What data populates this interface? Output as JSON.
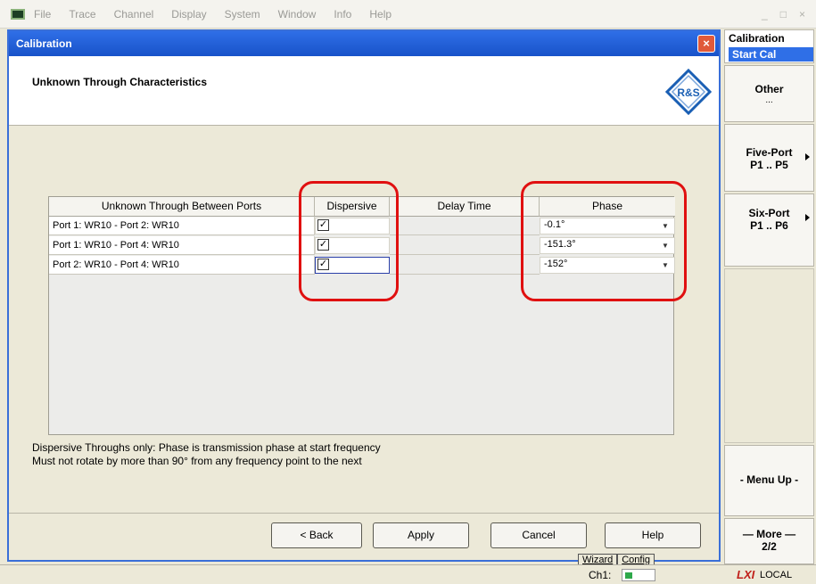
{
  "menubar": {
    "items": [
      "File",
      "Trace",
      "Channel",
      "Display",
      "System",
      "Window",
      "Info",
      "Help"
    ],
    "window_controls": [
      "_",
      "□",
      "×"
    ]
  },
  "dialog": {
    "title": "Calibration",
    "close_label": "×",
    "heading": "Unknown Through Characteristics",
    "logo_text": "R&S"
  },
  "grid": {
    "columns": [
      "Unknown Through Between Ports",
      "Dispersive",
      "Delay Time",
      "Phase"
    ],
    "rows": [
      {
        "ports": "Port 1: WR10 - Port 2: WR10",
        "dispersive": true,
        "delay": "",
        "phase": "-0.1°"
      },
      {
        "ports": "Port 1: WR10 - Port 4: WR10",
        "dispersive": true,
        "delay": "",
        "phase": "-151.3°"
      },
      {
        "ports": "Port 2: WR10 - Port 4: WR10",
        "dispersive": true,
        "delay": "",
        "phase": "-152°"
      }
    ]
  },
  "notes": {
    "line1": "Dispersive Throughs only: Phase is transmission phase at start frequency",
    "line2": "Must not rotate by more than 90° from any frequency point to the next"
  },
  "buttons": {
    "back": "< Back",
    "apply": "Apply",
    "cancel": "Cancel",
    "help": "Help"
  },
  "softkeys": {
    "title": "Calibration",
    "subtitle": "Start Cal",
    "other": "Other",
    "other_sub": "...",
    "five_port": "Five-Port",
    "five_port_sub": "P1 .. P5",
    "six_port": "Six-Port",
    "six_port_sub": "P1 .. P6",
    "menu_up": "- Menu Up -",
    "more": "— More —",
    "more_sub": "2/2"
  },
  "statusbar": {
    "wizard": "Wizard",
    "config": "Config",
    "channel": "Ch1:",
    "lxi": "LXI",
    "local": "LOCAL"
  },
  "colors": {
    "title_blue": "#2f6fe7",
    "highlight_red": "#e01010",
    "dialog_bg": "#ece9d8"
  }
}
